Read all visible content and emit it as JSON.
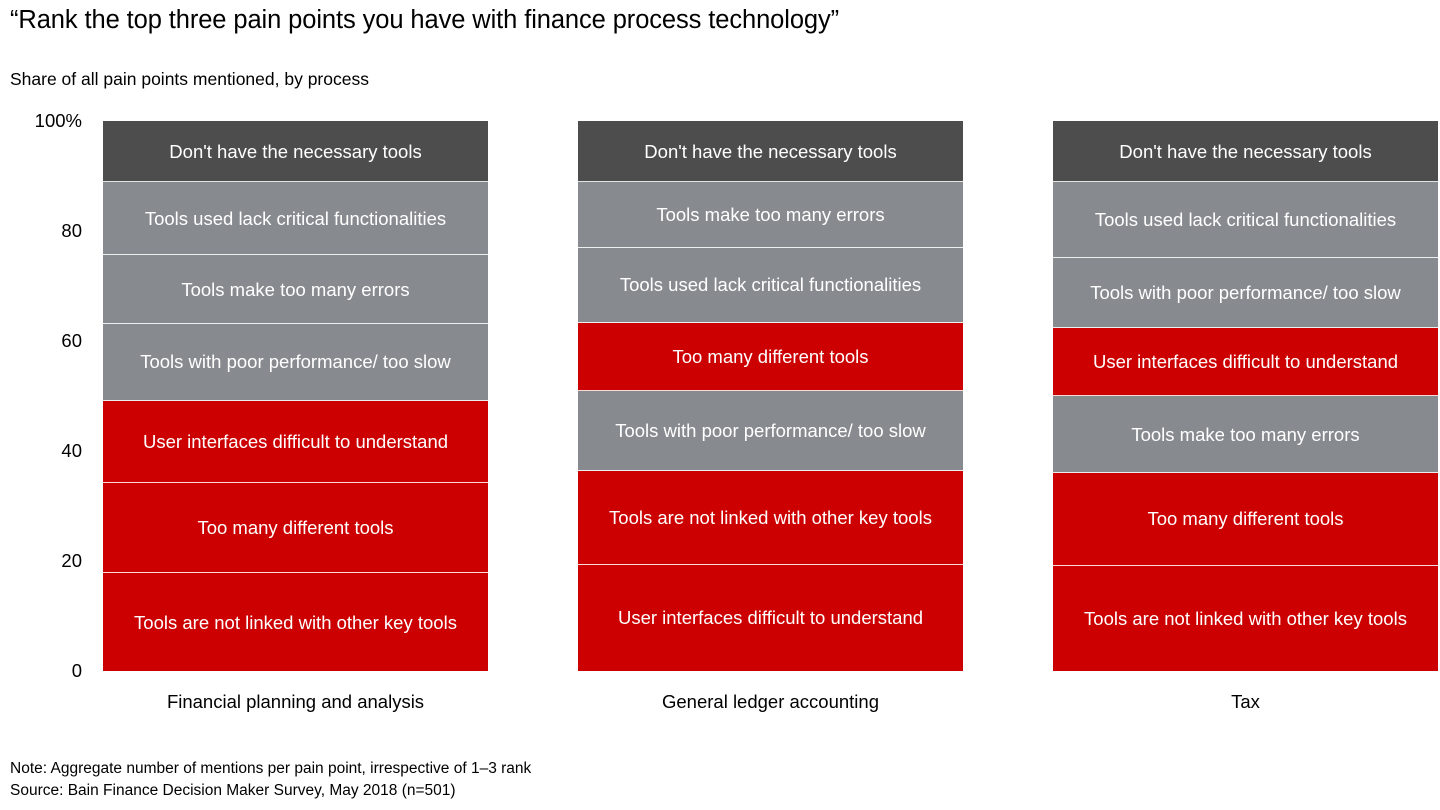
{
  "header": {
    "title": "“Rank the top three pain points you have with finance process technology”",
    "subtitle": "Share of all pain points mentioned, by process"
  },
  "footnotes": {
    "note": "Note: Aggregate number of mentions per pain point, irrespective of 1–3 rank",
    "source": "Source: Bain Finance Decision Maker Survey, May 2018 (n=501)"
  },
  "colors": {
    "dark_gray": "#4d4d4d",
    "gray": "#878b8f",
    "red": "#cc0000",
    "segment_divider": "#ffffff",
    "text_on_segment": "#ffffff",
    "axis_text": "#000000"
  },
  "chart_data": {
    "type": "bar",
    "subtype": "stacked-100-percent",
    "title": "“Rank the top three pain points you have with finance process technology”",
    "subtitle": "Share of all pain points mentioned, by process",
    "xlabel": "",
    "ylabel": "",
    "ylim": [
      0,
      100
    ],
    "ytick_labels": [
      "100%",
      "80",
      "60",
      "40",
      "20",
      "0"
    ],
    "ytick_values": [
      100,
      80,
      60,
      40,
      20,
      0
    ],
    "grid": false,
    "legend": "none",
    "stack_order": "top-to-bottom",
    "categories": [
      "Financial planning and analysis",
      "General ledger accounting",
      "Tax"
    ],
    "columns": [
      {
        "category": "Financial planning and analysis",
        "segments": [
          {
            "label": "Don't have the necessary tools",
            "value": 11.1,
            "color": "#4d4d4d"
          },
          {
            "label": "Tools used lack critical functionalities",
            "value": 13.3,
            "color": "#878b8f"
          },
          {
            "label": "Tools make too many errors",
            "value": 12.5,
            "color": "#878b8f"
          },
          {
            "label": "Tools with poor performance/ too slow",
            "value": 14.0,
            "color": "#878b8f"
          },
          {
            "label": "User interfaces difficult to understand",
            "value": 14.9,
            "color": "#cc0000"
          },
          {
            "label": "Too many different tools",
            "value": 16.4,
            "color": "#cc0000"
          },
          {
            "label": "Tools are not linked with other key tools",
            "value": 17.8,
            "color": "#cc0000"
          }
        ]
      },
      {
        "category": "General ledger accounting",
        "segments": [
          {
            "label": "Don't have the necessary tools",
            "value": 11.1,
            "color": "#4d4d4d"
          },
          {
            "label": "Tools make too many errors",
            "value": 12.0,
            "color": "#878b8f"
          },
          {
            "label": "Tools used lack critical functionalities",
            "value": 13.6,
            "color": "#878b8f"
          },
          {
            "label": "Too many different tools",
            "value": 12.4,
            "color": "#cc0000"
          },
          {
            "label": "Tools with poor performance/ too slow",
            "value": 14.5,
            "color": "#878b8f"
          },
          {
            "label": "Tools are not linked with other key tools",
            "value": 17.1,
            "color": "#cc0000"
          },
          {
            "label": "User interfaces difficult to understand",
            "value": 19.3,
            "color": "#cc0000"
          }
        ]
      },
      {
        "category": "Tax",
        "segments": [
          {
            "label": "Don't have the necessary tools",
            "value": 11.1,
            "color": "#4d4d4d"
          },
          {
            "label": "Tools used lack critical functionalities",
            "value": 13.8,
            "color": "#878b8f"
          },
          {
            "label": "Tools with poor performance/ too slow",
            "value": 12.7,
            "color": "#878b8f"
          },
          {
            "label": "User interfaces difficult to understand",
            "value": 12.4,
            "color": "#cc0000"
          },
          {
            "label": "Tools make too many errors",
            "value": 14.0,
            "color": "#878b8f"
          },
          {
            "label": "Too many different tools",
            "value": 16.9,
            "color": "#cc0000"
          },
          {
            "label": "Tools are not linked with other key tools",
            "value": 19.1,
            "color": "#cc0000"
          }
        ]
      }
    ]
  }
}
